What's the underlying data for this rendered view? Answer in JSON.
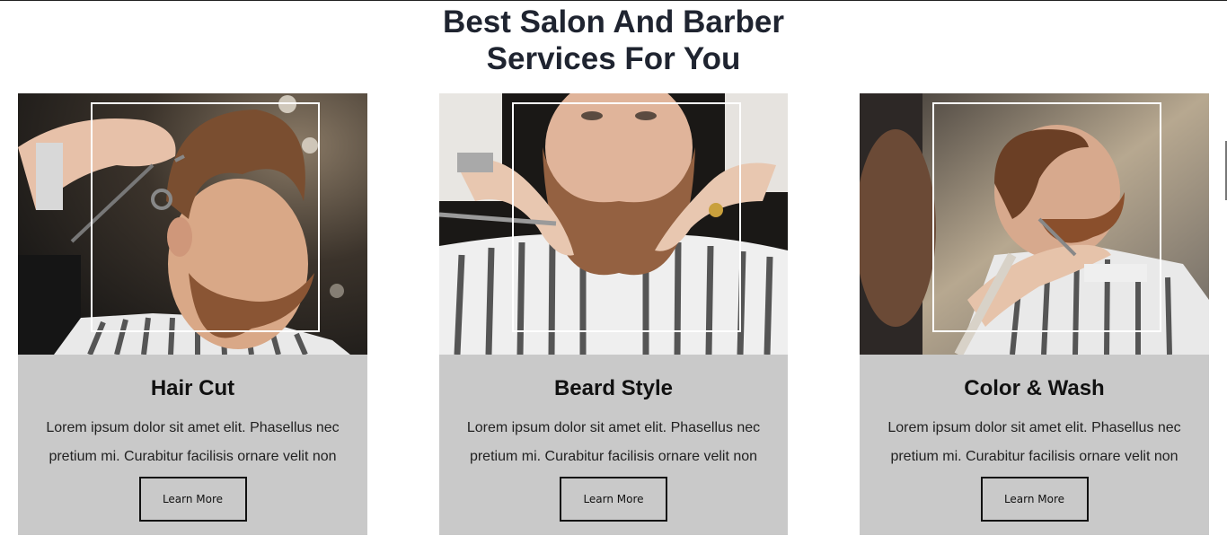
{
  "section": {
    "heading_line1": "Best Salon And Barber",
    "heading_line2": "Services For You"
  },
  "services": [
    {
      "title": "Hair Cut",
      "description": "Lorem ipsum dolor sit amet elit. Phasellus nec pretium mi. Curabitur facilisis ornare velit non",
      "button_label": "Learn More",
      "image": "barber-hair-cut-photo"
    },
    {
      "title": "Beard Style",
      "description": "Lorem ipsum dolor sit amet elit. Phasellus nec pretium mi. Curabitur facilisis ornare velit non",
      "button_label": "Learn More",
      "image": "barber-beard-style-photo"
    },
    {
      "title": "Color & Wash",
      "description": "Lorem ipsum dolor sit amet elit. Phasellus nec pretium mi. Curabitur facilisis ornare velit non",
      "button_label": "Learn More",
      "image": "barber-beard-trim-photo"
    }
  ],
  "colors": {
    "card_body": "#c9c9c9",
    "heading_text": "#1f2430",
    "frame": "#ffffff"
  }
}
